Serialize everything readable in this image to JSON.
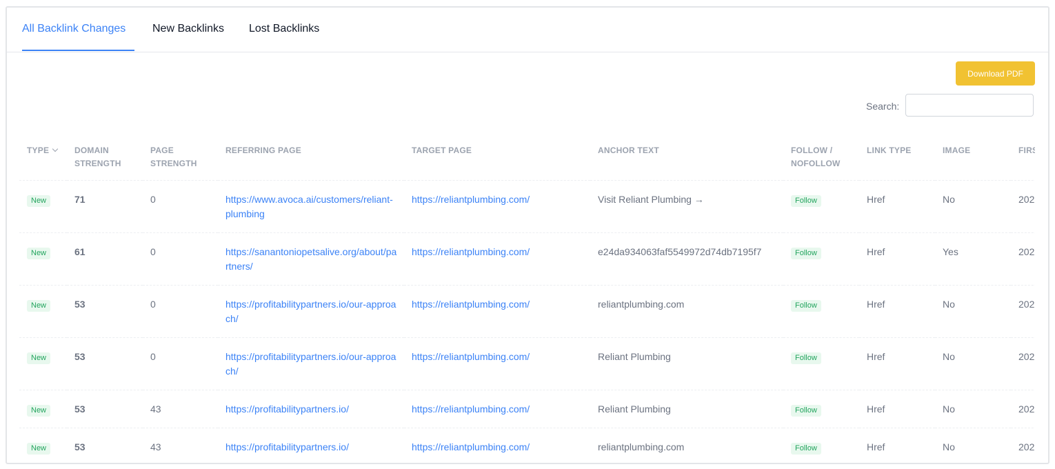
{
  "tabs": [
    {
      "label": "All Backlink Changes",
      "active": true
    },
    {
      "label": "New Backlinks",
      "active": false
    },
    {
      "label": "Lost Backlinks",
      "active": false
    }
  ],
  "toolbar": {
    "download_label": "Download PDF"
  },
  "search": {
    "label": "Search:",
    "value": "",
    "placeholder": ""
  },
  "colors": {
    "accent": "#3b82f6",
    "download_button": "#f1c232",
    "badge_green": "#22a45d",
    "badge_bg": "#e8f8ee"
  },
  "table": {
    "headers": {
      "type": "TYPE",
      "domain_strength": "DOMAIN STRENGTH",
      "page_strength": "PAGE STRENGTH",
      "referring_page": "REFERRING PAGE",
      "target_page": "TARGET PAGE",
      "anchor_text": "ANCHOR TEXT",
      "follow": "FOLLOW / NOFOLLOW",
      "link_type": "LINK TYPE",
      "image": "IMAGE",
      "first_seen": "FIRS"
    },
    "rows": [
      {
        "type": "New",
        "domain_strength": "71",
        "page_strength": "0",
        "referring_page": "https://www.avoca.ai/customers/reliant-plumbing",
        "target_page": "https://reliantplumbing.com/",
        "anchor_text": "Visit Reliant Plumbing →",
        "follow": "Follow",
        "link_type": "Href",
        "image": "No",
        "first_seen": "202"
      },
      {
        "type": "New",
        "domain_strength": "61",
        "page_strength": "0",
        "referring_page": "https://sanantoniopetsalive.org/about/partners/",
        "target_page": "https://reliantplumbing.com/",
        "anchor_text": "e24da934063faf5549972d74db7195f7",
        "follow": "Follow",
        "link_type": "Href",
        "image": "Yes",
        "first_seen": "202"
      },
      {
        "type": "New",
        "domain_strength": "53",
        "page_strength": "0",
        "referring_page": "https://profitabilitypartners.io/our-approach/",
        "target_page": "https://reliantplumbing.com/",
        "anchor_text": "reliantplumbing.com",
        "follow": "Follow",
        "link_type": "Href",
        "image": "No",
        "first_seen": "202"
      },
      {
        "type": "New",
        "domain_strength": "53",
        "page_strength": "0",
        "referring_page": "https://profitabilitypartners.io/our-approach/",
        "target_page": "https://reliantplumbing.com/",
        "anchor_text": "Reliant Plumbing",
        "follow": "Follow",
        "link_type": "Href",
        "image": "No",
        "first_seen": "202"
      },
      {
        "type": "New",
        "domain_strength": "53",
        "page_strength": "43",
        "referring_page": "https://profitabilitypartners.io/",
        "target_page": "https://reliantplumbing.com/",
        "anchor_text": "Reliant Plumbing",
        "follow": "Follow",
        "link_type": "Href",
        "image": "No",
        "first_seen": "202"
      },
      {
        "type": "New",
        "domain_strength": "53",
        "page_strength": "43",
        "referring_page": "https://profitabilitypartners.io/",
        "target_page": "https://reliantplumbing.com/",
        "anchor_text": "reliantplumbing.com",
        "follow": "Follow",
        "link_type": "Href",
        "image": "No",
        "first_seen": "202"
      }
    ]
  }
}
